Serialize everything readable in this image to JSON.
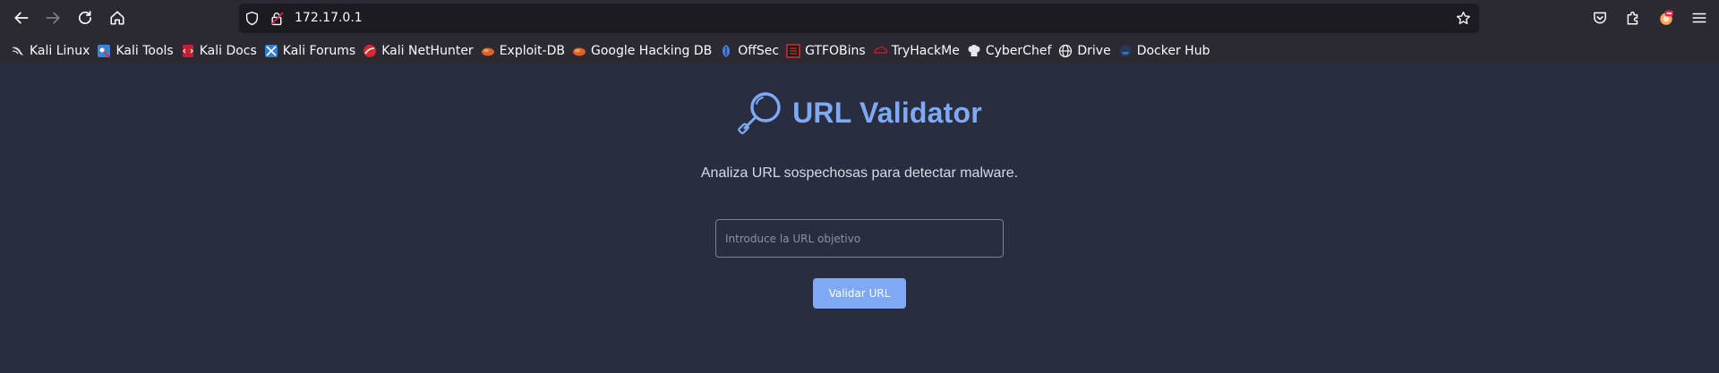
{
  "browser": {
    "url": "172.17.0.1",
    "bookmarks": [
      {
        "label": "Kali Linux",
        "icon": "kali-dragon-icon"
      },
      {
        "label": "Kali Tools",
        "icon": "kali-tools-icon"
      },
      {
        "label": "Kali Docs",
        "icon": "kali-docs-icon"
      },
      {
        "label": "Kali Forums",
        "icon": "kali-forums-icon"
      },
      {
        "label": "Kali NetHunter",
        "icon": "kali-nethunter-icon"
      },
      {
        "label": "Exploit-DB",
        "icon": "exploit-db-icon"
      },
      {
        "label": "Google Hacking DB",
        "icon": "google-hacking-db-icon"
      },
      {
        "label": "OffSec",
        "icon": "offsec-icon"
      },
      {
        "label": "GTFOBins",
        "icon": "gtfobins-icon"
      },
      {
        "label": "TryHackMe",
        "icon": "tryhackme-icon"
      },
      {
        "label": "CyberChef",
        "icon": "cyberchef-icon"
      },
      {
        "label": "Drive",
        "icon": "globe-icon"
      },
      {
        "label": "Docker Hub",
        "icon": "docker-hub-icon"
      }
    ]
  },
  "app": {
    "title": "URL Validator",
    "subtitle": "Analiza URL sospechosas para detectar malware.",
    "input_placeholder": "Introduce la URL objetivo",
    "button_label": "Validar URL",
    "accent_color": "#7fa8f5",
    "background_color": "#282e40"
  }
}
